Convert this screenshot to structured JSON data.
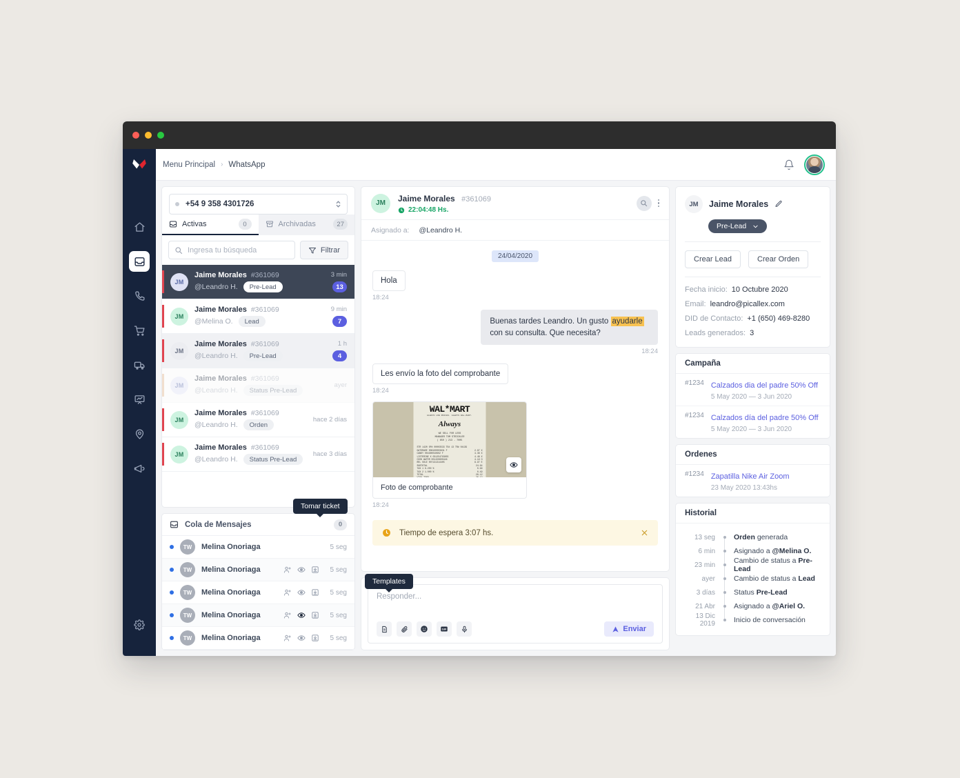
{
  "window": {
    "traffic_lights": [
      "close",
      "minimize",
      "maximize"
    ]
  },
  "topbar": {
    "breadcrumb_root": "Menu Principal",
    "breadcrumb_separator": "›",
    "breadcrumb_current": "WhatsApp",
    "bell_icon": "bell-icon",
    "avatar_icon": "user-avatar"
  },
  "rail": {
    "logo": "X",
    "items": [
      {
        "icon": "home-icon",
        "active": false
      },
      {
        "icon": "inbox-icon",
        "active": true
      },
      {
        "icon": "phone-icon",
        "active": false
      },
      {
        "icon": "cart-icon",
        "active": false
      },
      {
        "icon": "truck-icon",
        "active": false
      },
      {
        "icon": "presentation-chart-icon",
        "active": false
      },
      {
        "icon": "map-pin-icon",
        "active": false
      },
      {
        "icon": "megaphone-icon",
        "active": false
      }
    ],
    "settings": {
      "icon": "gear-icon"
    }
  },
  "list_panel": {
    "phone_number": "+54 9 358 4301726",
    "tabs": [
      {
        "label": "Activas",
        "count": "0",
        "icon": "inbox-icon",
        "active": true
      },
      {
        "label": "Archivadas",
        "count": "27",
        "icon": "archive-icon",
        "active": false
      }
    ],
    "search_placeholder": "Ingresa tu búsqueda",
    "search_value": "",
    "filter_label": "Filtrar",
    "conversations": [
      {
        "initials": "JM",
        "name": "Jaime Morales",
        "id": "#361069",
        "agent": "@Leandro H.",
        "tag": "Pre-Lead",
        "time": "3 min",
        "unread": "13",
        "state": "selected",
        "avatar_color": "lav"
      },
      {
        "initials": "JM",
        "name": "Jaime Morales",
        "id": "#361069",
        "agent": "@Melina O.",
        "tag": "Lead",
        "time": "9 min",
        "unread": "7",
        "state": "normal",
        "avatar_color": "green"
      },
      {
        "initials": "JM",
        "name": "Jaime Morales",
        "id": "#361069",
        "agent": "@Leandro H.",
        "tag": "Pre-Lead",
        "time": "1 h",
        "unread": "4",
        "state": "highlight",
        "avatar_color": "grey"
      },
      {
        "initials": "JM",
        "name": "Jaime Morales",
        "id": "#361069",
        "agent": "@Leandro H.",
        "tag": "Status Pre-Lead",
        "time": "ayer",
        "unread": "",
        "state": "dim",
        "avatar_color": "lav"
      },
      {
        "initials": "JM",
        "name": "Jaime Morales",
        "id": "#361069",
        "agent": "@Leandro H.",
        "tag": "Orden",
        "time": "hace 2 días",
        "unread": "",
        "state": "normal",
        "avatar_color": "green"
      },
      {
        "initials": "JM",
        "name": "Jaime Morales",
        "id": "#361069",
        "agent": "@Leandro H.",
        "tag": "Status Pre-Lead",
        "time": "hace 3 días",
        "unread": "",
        "state": "normal",
        "avatar_color": "green"
      }
    ]
  },
  "queue": {
    "title": "Cola de Mensajes",
    "count": "0",
    "icon": "inbox-icon",
    "tooltip": "Tomar ticket",
    "rows": [
      {
        "initials": "TW",
        "name": "Melina Onoriaga",
        "time": "5 seg",
        "icons_visible": false,
        "eye_active": false
      },
      {
        "initials": "TW",
        "name": "Melina Onoriaga",
        "time": "5 seg",
        "icons_visible": true,
        "eye_active": false
      },
      {
        "initials": "TW",
        "name": "Melina Onoriaga",
        "time": "5 seg",
        "icons_visible": true,
        "eye_active": false
      },
      {
        "initials": "TW",
        "name": "Melina Onoriaga",
        "time": "5 seg",
        "icons_visible": true,
        "eye_active": true
      },
      {
        "initials": "TW",
        "name": "Melina Onoriaga",
        "time": "5 seg",
        "icons_visible": true,
        "eye_active": false
      }
    ],
    "row_icons": [
      "add-person-icon",
      "eye-icon",
      "take-ticket-icon"
    ]
  },
  "chat": {
    "initials": "JM",
    "name": "Jaime Morales",
    "id": "#361069",
    "timer": "22:04:48 Hs.",
    "assigned_label": "Asignado a:",
    "assigned_value": "@Leandro H.",
    "date_chip": "24/04/2020",
    "messages": [
      {
        "dir": "in",
        "text": "Hola",
        "time": "18:24"
      },
      {
        "dir": "out",
        "text_before": "Buenas tardes Leandro.  Un gusto ",
        "highlight": "ayudarle",
        "text_after": " con su consulta. Que necesita?",
        "time": "18:24"
      },
      {
        "dir": "in",
        "text": "Les envío la foto del comprobante",
        "time": "18:24"
      }
    ],
    "attachment": {
      "caption": "Foto de comprobante",
      "time": "18:24",
      "eye_icon": "eye-icon",
      "receipt": {
        "logo": "WAL*MART",
        "tagline": "ALWAYS LOW PRICES. ALWAYS WAL-MART.",
        "brand": "Always",
        "lines": [
          "WE SELL FOR LESS",
          "MANAGER TOM STRICKLER",
          "( 650 ) 213 - 7005"
        ],
        "items": [
          [
            "STR 1420 OP# 00003533 TE# 13 TR# 04139",
            ""
          ],
          [
            "GATORADE       006100003831  F",
            "2.87 X"
          ],
          [
            "CANDY          004300010602  F",
            "4.36 X"
          ],
          [
            "LISTERINE  X  031254793855",
            "4.48 X"
          ],
          [
            "COOK WATER     001150900446",
            "4.19 O"
          ],
          [
            "REL SOLE       007131314405",
            "8.97 E"
          ],
          [
            "SUBTOTAL",
            "24.64"
          ],
          [
            "TAX 1      6.250 %",
            "0.99"
          ],
          [
            "TAX 2      1.000 %",
            "0.49"
          ],
          [
            "TOTAL",
            "26.12"
          ],
          [
            "VISA TEND",
            "26.12"
          ]
        ]
      }
    },
    "alert": {
      "icon": "clock-icon",
      "text": "Tiempo de espera 3:07 hs.",
      "close_icon": "close-icon"
    },
    "composer": {
      "placeholder": "Responder...",
      "value": "",
      "tooltip": "Templates",
      "tools": [
        "template-icon",
        "paperclip-icon",
        "emoji-icon",
        "gif-icon",
        "microphone-icon"
      ],
      "send_label": "Enviar",
      "send_icon": "send-icon"
    },
    "header_icons": [
      "search-icon",
      "kebab-menu-icon"
    ]
  },
  "contact_panel": {
    "initials": "JM",
    "name": "Jaime Morales",
    "edit_icon": "pencil-icon",
    "status": "Pre-Lead",
    "status_chevron": "chevron-down-icon",
    "actions": [
      {
        "label": "Crear Lead"
      },
      {
        "label": "Crear Orden"
      }
    ],
    "fields": [
      {
        "key": "Fecha inicio:",
        "value": "10 Octubre 2020"
      },
      {
        "key": "Email:",
        "value": "leandro@picallex.com"
      },
      {
        "key": "DID de Contacto:",
        "value": "+1 (650) 469-8280"
      },
      {
        "key": "Leads generados:",
        "value": "3"
      }
    ],
    "campaign": {
      "title": "Campaña",
      "items": [
        {
          "id": "#1234",
          "title": "Calzados dia del padre 50% Off",
          "sub": "5 May 2020 — 3 Jun 2020"
        },
        {
          "id": "#1234",
          "title": "Calzados día del padre 50% Off",
          "sub": "5 May 2020 — 3 Jun 2020"
        }
      ]
    },
    "orders": {
      "title": "Ordenes",
      "items": [
        {
          "id": "#1234",
          "title": "Zapatilla Nike Air Zoom",
          "sub": "23 May 2020 13:43hs"
        }
      ]
    },
    "history": {
      "title": "Historial",
      "entries": [
        {
          "time": "13 seg",
          "bold_first": "Orden",
          "rest": " generada",
          "bold_last": ""
        },
        {
          "time": "6 min",
          "bold_first": "",
          "rest": "Asignado a ",
          "bold_last": "@Melina O."
        },
        {
          "time": "23 min",
          "bold_first": "",
          "rest": "Cambio de status a ",
          "bold_last": "Pre-Lead"
        },
        {
          "time": "ayer",
          "bold_first": "",
          "rest": "Cambio de status a ",
          "bold_last": "Lead"
        },
        {
          "time": "3 días",
          "bold_first": "",
          "rest": "Status ",
          "bold_last": "Pre-Lead"
        },
        {
          "time": "21 Abr",
          "bold_first": "",
          "rest": "Asignado a ",
          "bold_last": "@Ariel O."
        },
        {
          "time": "13 Dic 2019",
          "bold_first": "",
          "rest": "Inicio de conversación",
          "bold_last": ""
        }
      ]
    }
  },
  "colors": {
    "accent_indigo": "#5b5fe0",
    "rail_navy": "#16233c",
    "selected_row": "#3d4656",
    "green_status": "#18a566",
    "alert_yellow": "#fdf7e3",
    "highlight_yellow": "#f8c251",
    "red_marker": "#e0444f",
    "avatar_ring_green": "#21c08b"
  }
}
